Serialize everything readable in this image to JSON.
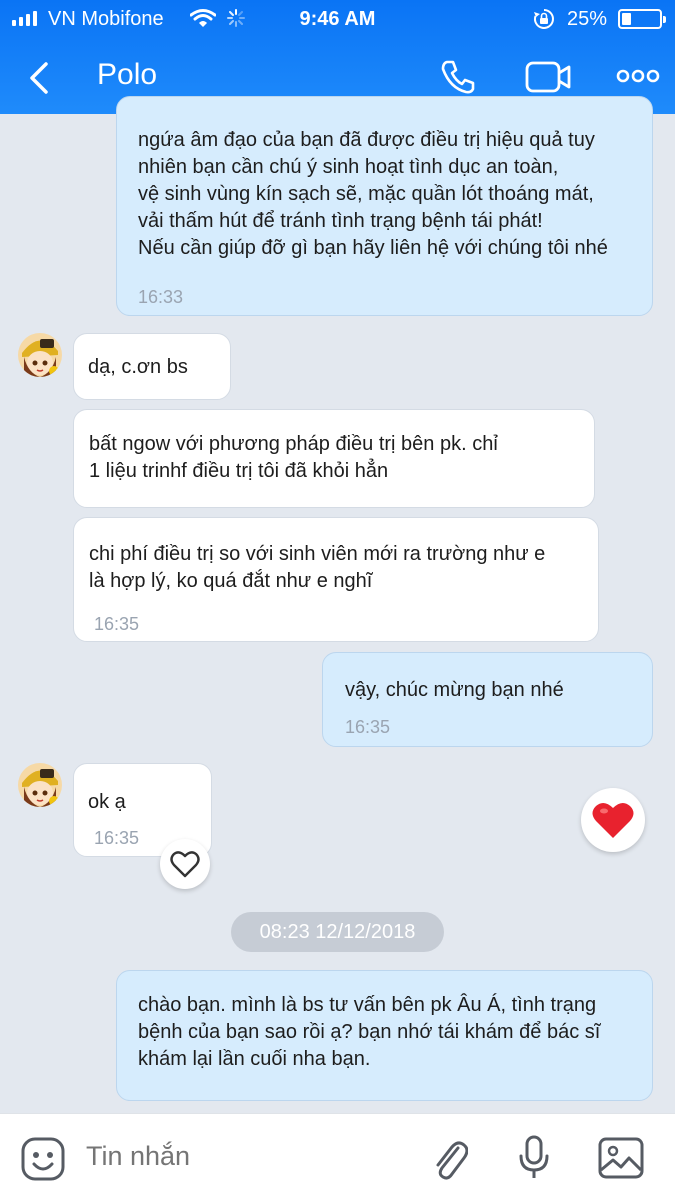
{
  "status_bar": {
    "carrier": "VN Mobifone",
    "time": "9:46 AM",
    "battery": "25%",
    "battery_level": 0.25
  },
  "header": {
    "back_icon": "chevron-left-icon",
    "contact_name": "Polo",
    "call_icon": "phone-icon",
    "video_icon": "video-camera-icon",
    "more_icon": "more-horizontal-icon"
  },
  "messages": [
    {
      "direction": "out",
      "text": "ngứa âm đạo của bạn đã được điều trị hiệu quả tuy\nnhiên bạn cần chú ý sinh hoạt tình dục an toàn,\nvệ sinh vùng kín sạch sẽ, mặc quần lót thoáng mát,\nvải thấm hút để tránh tình trạng bệnh tái phát!\nNếu cần giúp đỡ gì bạn hãy liên hệ với chúng tôi nhé",
      "time": "16:33"
    },
    {
      "direction": "in",
      "text": "dạ, c.ơn bs",
      "time": ""
    },
    {
      "direction": "in",
      "text": "bất ngow với phương pháp điều trị bên pk. chỉ\n1 liệu trinhf điều trị tôi đã khỏi hẳn",
      "time": ""
    },
    {
      "direction": "in",
      "text": "chi phí điều trị so với sinh viên mới ra trường như e\nlà hợp lý, ko quá đắt như e nghĩ",
      "time": "16:35"
    },
    {
      "direction": "out",
      "text": "vậy, chúc mừng bạn nhé",
      "time": "16:35"
    },
    {
      "direction": "in",
      "text": "ok ạ",
      "time": "16:35"
    },
    {
      "direction": "out",
      "text": "chào bạn. mình là bs tư vấn bên pk Âu Á, tình trạng\nbệnh của bạn sao rồi ạ? bạn nhớ tái khám để bác sĩ\nkhám lại lần cuối nha bạn.",
      "time": ""
    }
  ],
  "date_separator": "08:23 12/12/2018",
  "reactions": {
    "like_outline_icon": "heart-outline-icon",
    "like_filled_icon": "heart-filled-icon",
    "heart_color": "#e8222e"
  },
  "input_bar": {
    "placeholder": "Tin nhắn",
    "sticker_icon": "smiley-icon",
    "attach_icon": "paperclip-icon",
    "mic_icon": "microphone-icon",
    "image_icon": "image-icon"
  },
  "colors": {
    "header": "#1585f8",
    "outgoing_bubble": "#d6ecfd",
    "incoming_bubble": "#ffffff",
    "background": "#e3e8ef"
  }
}
